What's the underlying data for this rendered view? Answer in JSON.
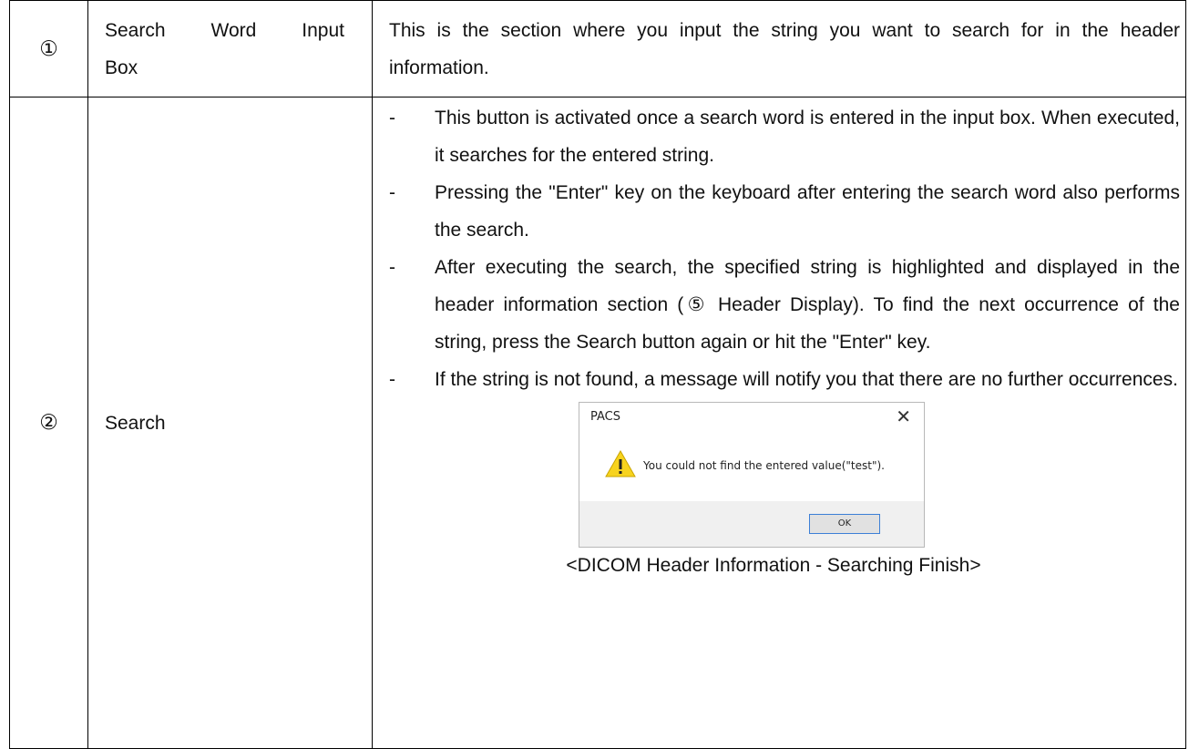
{
  "rows": [
    {
      "number": "①",
      "name_line1": "Search Word Input",
      "name_line2": "Box",
      "description": "This is the section where you input the string you want to search for in the header information."
    },
    {
      "number": "②",
      "name": "Search",
      "bullets": [
        "This button is activated once a search word is entered in the input box. When executed, it searches for the entered string.",
        "Pressing the \"Enter\" key on the keyboard after entering the search word also performs the search.",
        "After executing the search, the specified string is highlighted and displayed in the header information section (⑤ Header Display). To find the next occurrence of the string, press the Search button again or hit the \"Enter\" key.",
        "If the string is not found, a message will notify you that there are no further occurrences."
      ],
      "bullet_marker": "-",
      "dialog": {
        "title": "PACS",
        "close_glyph": "✕",
        "icon": "warning-icon",
        "message": "You could not find the entered value(\"test\").",
        "ok_label": "OK"
      },
      "caption": "<DICOM Header Information - Searching Finish>"
    }
  ],
  "colors": {
    "border": "#000000",
    "dialog_footer": "#f0f0f0",
    "ok_border": "#3c7fd6",
    "warning_fill": "#f7d31e"
  }
}
